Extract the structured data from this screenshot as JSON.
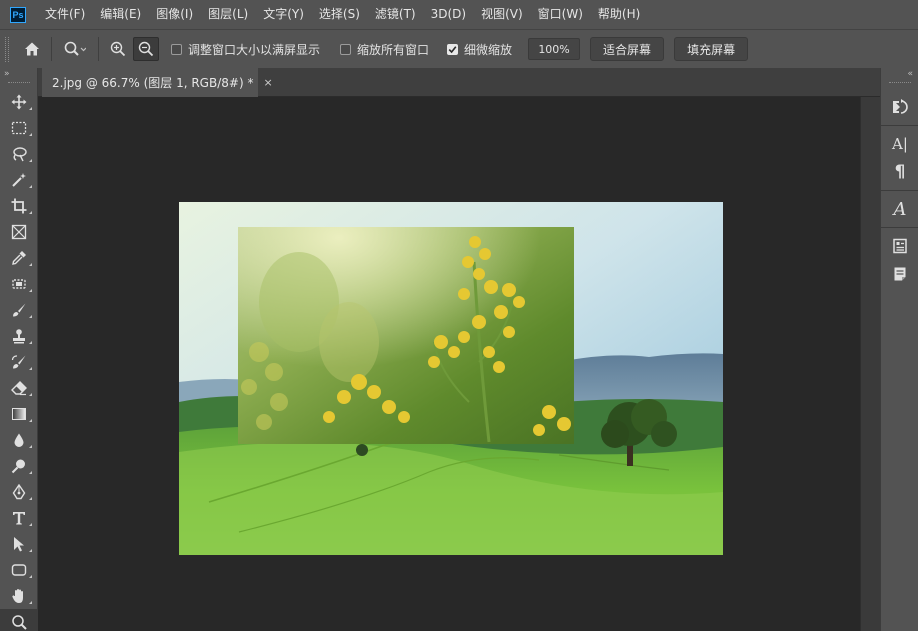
{
  "app": {
    "logo_text": "Ps"
  },
  "menu": [
    "文件(F)",
    "编辑(E)",
    "图像(I)",
    "图层(L)",
    "文字(Y)",
    "选择(S)",
    "滤镜(T)",
    "3D(D)",
    "视图(V)",
    "窗口(W)",
    "帮助(H)"
  ],
  "options": {
    "resize_windows_label": "调整窗口大小以满屏显示",
    "resize_windows_checked": false,
    "zoom_all_label": "缩放所有窗口",
    "zoom_all_checked": false,
    "scrubby_zoom_label": "细微缩放",
    "scrubby_zoom_checked": true,
    "zoom_value": "100%",
    "fit_screen_label": "适合屏幕",
    "fill_screen_label": "填充屏幕"
  },
  "document": {
    "tab_title": "2.jpg @ 66.7% (图层 1, RGB/8#) *",
    "close_glyph": "×"
  },
  "toolbar": {
    "collapse_glyph": "»",
    "tools": [
      "move-tool",
      "marquee-tool",
      "lasso-tool",
      "magic-wand-tool",
      "crop-tool",
      "frame-tool",
      "eyedropper-tool",
      "healing-brush-tool",
      "brush-tool",
      "clone-stamp-tool",
      "history-brush-tool",
      "eraser-tool",
      "gradient-tool",
      "blur-tool",
      "dodge-tool",
      "pen-tool",
      "type-tool",
      "path-selection-tool",
      "rectangle-tool",
      "hand-tool",
      "zoom-tool"
    ]
  },
  "right_panel": {
    "collapse_glyph": "«",
    "icons": [
      "history-icon",
      "character-icon",
      "paragraph-icon",
      "glyphs-icon",
      "properties-icon",
      "notes-icon"
    ],
    "character_text": "A|",
    "paragraph_text": "¶",
    "glyphs_text": "A"
  }
}
